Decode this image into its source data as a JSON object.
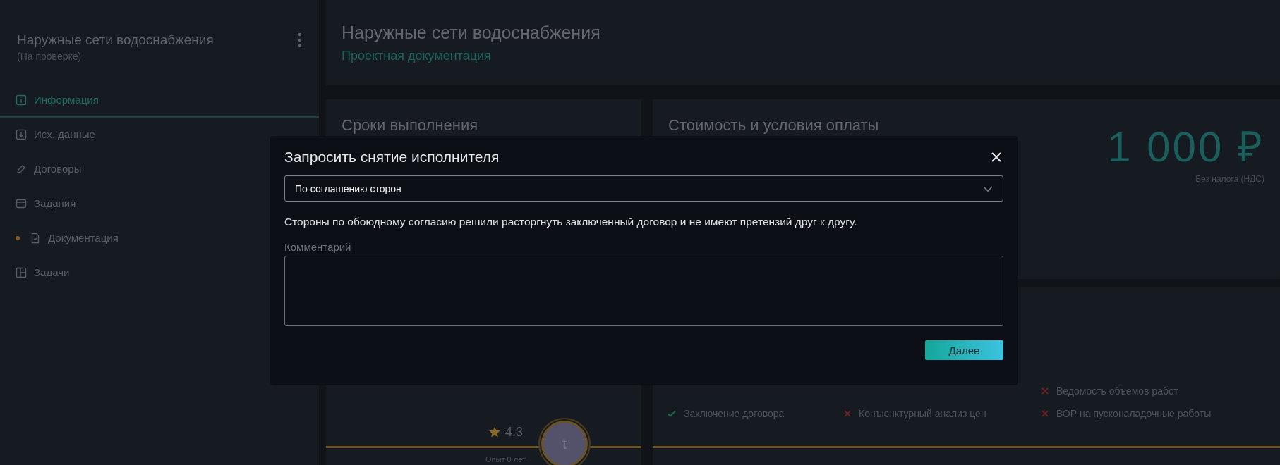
{
  "sidebar": {
    "title": "Наружные сети водоснабжения",
    "status": "(На проверке)",
    "items": [
      {
        "label": "Информация",
        "selected": true,
        "flag": false
      },
      {
        "label": "Исх. данные",
        "selected": false,
        "flag": false
      },
      {
        "label": "Договоры",
        "selected": false,
        "flag": false
      },
      {
        "label": "Задания",
        "selected": false,
        "flag": false
      },
      {
        "label": "Документация",
        "selected": false,
        "flag": true
      },
      {
        "label": "Задачи",
        "selected": false,
        "flag": false
      }
    ]
  },
  "header": {
    "title": "Наружные сети водоснабжения",
    "subtitle": "Проектная документация"
  },
  "schedule": {
    "title": "Сроки выполнения",
    "rating": "4.3",
    "avatar_letter": "t",
    "experience": "Опыт 0 лет"
  },
  "payment": {
    "title": "Стоимость и условия оплаты",
    "price": "1 000 ₽",
    "tax_note": "Без налога (НДС)"
  },
  "stages": [
    {
      "label": "Ведомость объемов работ",
      "done": false
    },
    {
      "label": "Заключение договора",
      "done": true
    },
    {
      "label": "Конъюнктурный анализ цен",
      "done": false
    },
    {
      "label": "ВОР на пусконаладочные работы",
      "done": false
    }
  ],
  "dialog": {
    "title": "Запросить снятие исполнителя",
    "reason": "По соглашению сторон",
    "description": "Стороны по обоюдному согласию решили расторгнуть заключенный договор и не имеют претензий друг к другу.",
    "comment_label": "Комментарий",
    "submit": "Далее"
  }
}
